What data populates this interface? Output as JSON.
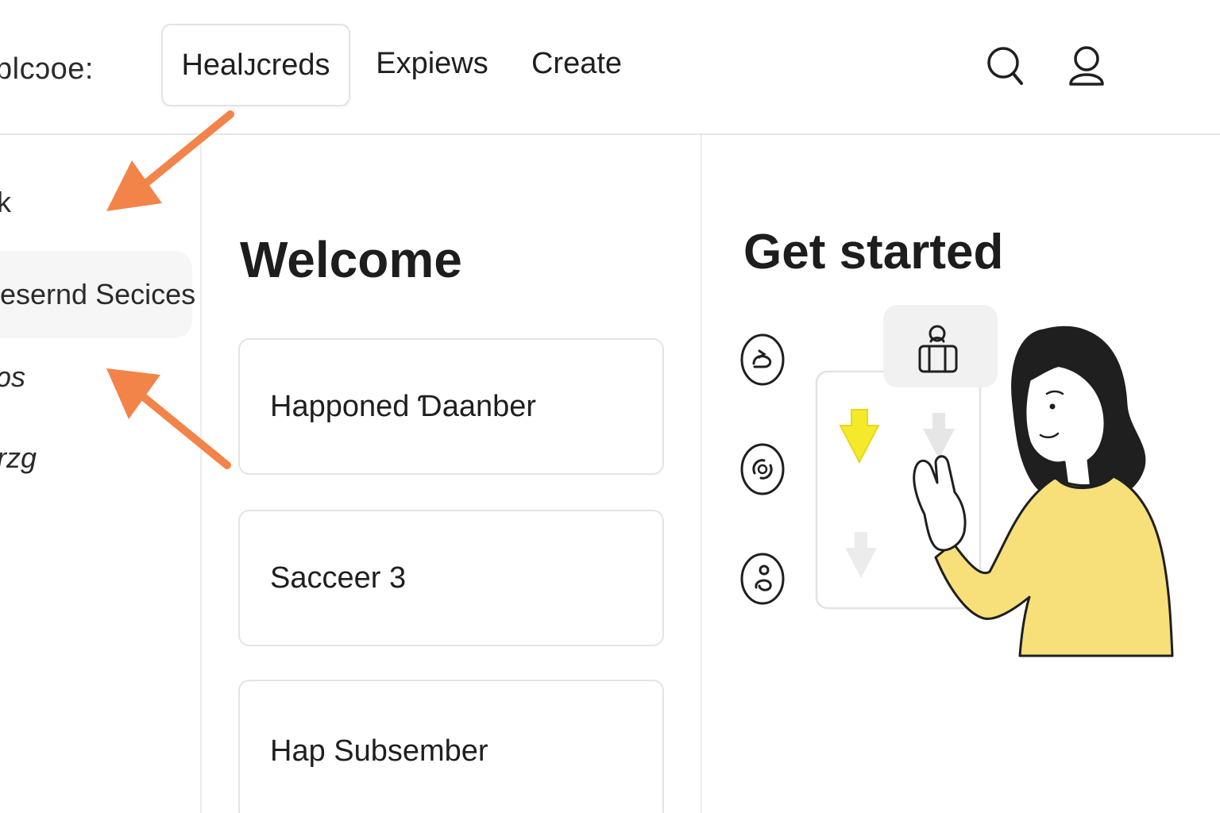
{
  "header": {
    "brand": "plcɔoe:",
    "tabs": [
      {
        "label": "Healᴊcreds",
        "active": true
      },
      {
        "label": "Expiews",
        "active": false
      },
      {
        "label": "Create",
        "active": false
      }
    ],
    "icons": [
      "search-icon",
      "user-icon"
    ]
  },
  "sidebar": {
    "items": [
      {
        "label": "k"
      },
      {
        "label": "esernd Secices",
        "active": true
      },
      {
        "label": "ɔs"
      },
      {
        "label": "rzg"
      }
    ]
  },
  "main": {
    "title": "Welcome",
    "cards": [
      {
        "label": "Hapроned Ɗaanber"
      },
      {
        "label": "Sacceer 3"
      },
      {
        "label": "Hap Subsember"
      }
    ]
  },
  "right_panel": {
    "title": "Get started",
    "buttons": [
      "refresh-icon",
      "cycle-icon",
      "person-icon"
    ]
  },
  "colors": {
    "arrow": "#f2844a",
    "accent_yellow": "#f7e07a",
    "highlight_yellow": "#f5ea2a",
    "border": "#e4e4e4"
  }
}
